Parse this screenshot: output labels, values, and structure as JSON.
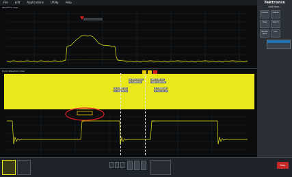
{
  "menu": {
    "items": [
      "File",
      "Edit",
      "Applications",
      "Utility",
      "Help"
    ]
  },
  "brand": {
    "name": "Tektronix",
    "add_new": "Add New..."
  },
  "side_buttons": [
    {
      "label": "Cursors"
    },
    {
      "label": "Callout"
    },
    {
      "label": "Meas"
    },
    {
      "label": "Search"
    },
    {
      "label": "Results Table"
    },
    {
      "label": "Plot"
    }
  ],
  "colors": {
    "ch1": "#e8e81a",
    "zoom_box": "#e8c800",
    "annotation": "#d8201e",
    "stop": "#c62828"
  },
  "waveform_view": {
    "title": "Waveform View"
  },
  "zoom_view": {
    "title": "Zoom Waveform View"
  },
  "cursor_readouts": {
    "top_left": "a: 874.112 µs",
    "top_right": "∆dt: 1.23 ms",
    "top_left2": "b: 1.258 ms",
    "top_right2": "1/∆t: 1.04 kHz",
    "mid_left": "a: -1.865 ms",
    "mid_left2": "b: 48.839 ms",
    "mid_right": "a: 1.890 ms",
    "mid_right2": "b: 50.213 ms"
  },
  "stop_button": "Stop"
}
